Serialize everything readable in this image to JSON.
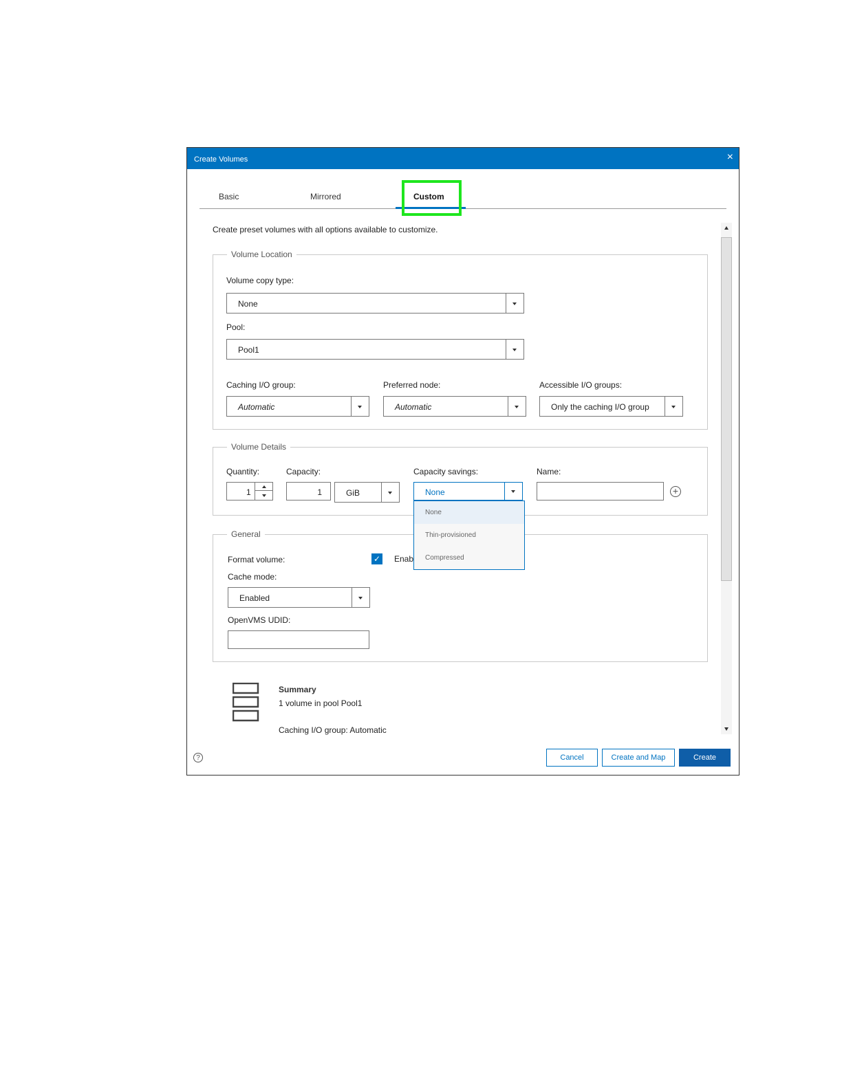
{
  "window": {
    "title": "Create Volumes",
    "close": "×"
  },
  "tabs": [
    {
      "label": "Basic"
    },
    {
      "label": "Mirrored"
    },
    {
      "label": "Custom"
    }
  ],
  "description": "Create preset volumes with all options available to customize.",
  "volume_location": {
    "legend": "Volume Location",
    "copy_type_label": "Volume copy type:",
    "copy_type_value": "None",
    "pool_label": "Pool:",
    "pool_value": "Pool1",
    "caching_label": "Caching I/O group:",
    "caching_value": "Automatic",
    "preferred_label": "Preferred node:",
    "preferred_value": "Automatic",
    "accessible_label": "Accessible I/O groups:",
    "accessible_value": "Only the caching I/O group"
  },
  "volume_details": {
    "legend": "Volume Details",
    "quantity_label": "Quantity:",
    "quantity_value": "1",
    "capacity_label": "Capacity:",
    "capacity_value": "1",
    "capacity_unit": "GiB",
    "savings_label": "Capacity savings:",
    "savings_value": "None",
    "savings_options": [
      "None",
      "Thin-provisioned",
      "Compressed"
    ],
    "name_label": "Name:",
    "name_value": ""
  },
  "general": {
    "legend": "General",
    "format_label": "Format volume:",
    "format_checked_text": "Enab",
    "cache_label": "Cache mode:",
    "cache_value": "Enabled",
    "udid_label": "OpenVMS UDID:",
    "udid_value": ""
  },
  "summary": {
    "title": "Summary",
    "line1": "1 volume in pool Pool1",
    "line2": "Caching I/O group: Automatic"
  },
  "footer": {
    "help": "?",
    "cancel": "Cancel",
    "create_map": "Create and Map",
    "create": "Create"
  }
}
